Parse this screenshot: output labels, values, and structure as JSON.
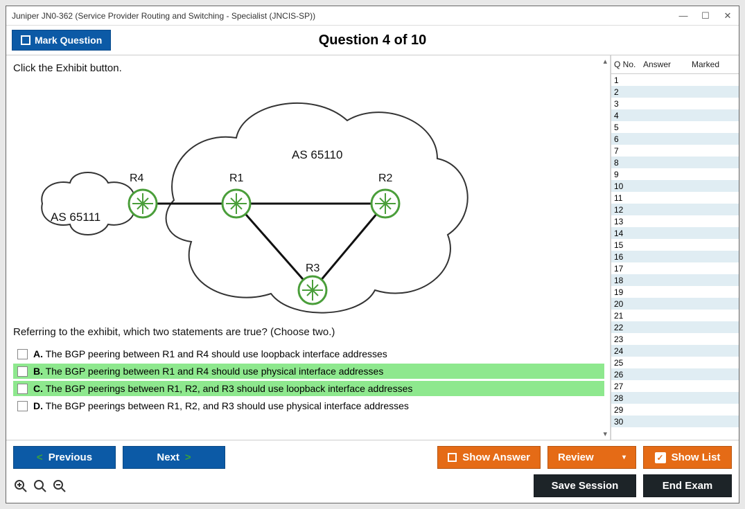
{
  "window": {
    "title": "Juniper JN0-362 (Service Provider Routing and Switching - Specialist (JNCIS-SP))"
  },
  "header": {
    "mark_label": "Mark Question",
    "question_counter": "Question 4 of 10"
  },
  "question": {
    "intro": "Click the Exhibit button.",
    "prompt": "Referring to the exhibit, which two statements are true? (Choose two.)",
    "options": [
      {
        "letter": "A.",
        "text": "The BGP peering between R1 and R4 should use loopback interface addresses",
        "correct": false
      },
      {
        "letter": "B.",
        "text": "The BGP peering between R1 and R4 should use physical interface addresses",
        "correct": true
      },
      {
        "letter": "C.",
        "text": "The BGP peerings between R1, R2, and R3 should use loopback interface addresses",
        "correct": true
      },
      {
        "letter": "D.",
        "text": "The BGP peerings between R1, R2, and R3 should use physical interface addresses",
        "correct": false
      }
    ]
  },
  "diagram": {
    "as_big": "AS 65110",
    "as_small": "AS 65111",
    "routers": {
      "r1": "R1",
      "r2": "R2",
      "r3": "R3",
      "r4": "R4"
    }
  },
  "side": {
    "headers": {
      "qno": "Q No.",
      "answer": "Answer",
      "marked": "Marked"
    },
    "count": 30
  },
  "footer": {
    "previous": "Previous",
    "next": "Next",
    "show_answer": "Show Answer",
    "review": "Review",
    "show_list": "Show List",
    "save_session": "Save Session",
    "end_exam": "End Exam"
  }
}
